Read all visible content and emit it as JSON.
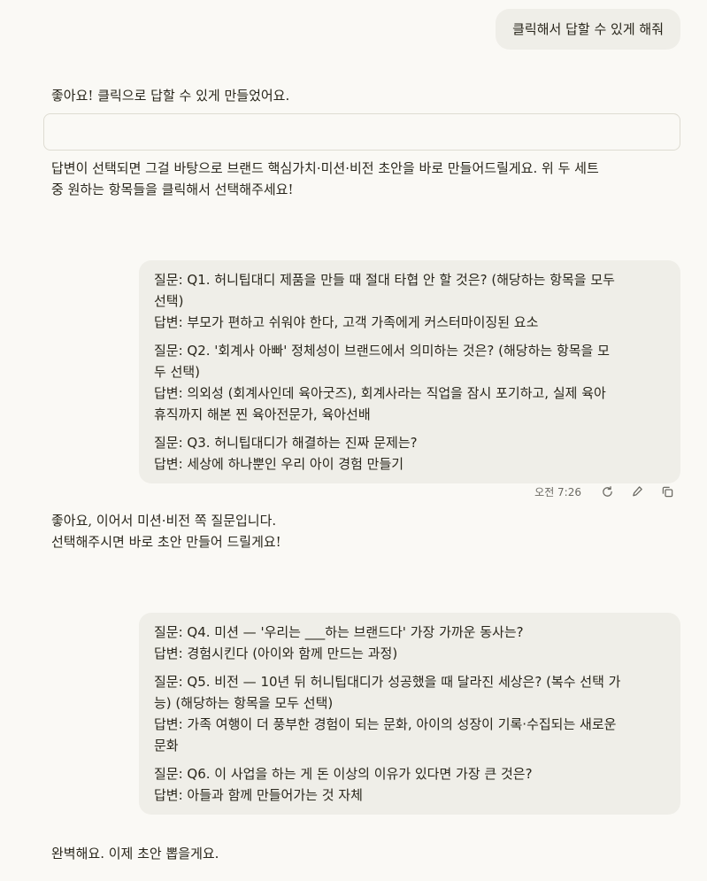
{
  "user_messages": {
    "first": "클릭해서 답할 수 있게 해줘"
  },
  "assistant": {
    "msg1_line1": "좋아요! 클릭으로 답할 수 있게 만들었어요.",
    "msg2_line1": "답변이 선택되면 그걸 바탕으로 브랜드 핵심가치·미션·비전 초안을 바로 만들어드릴게요. 위 두 세트",
    "msg2_line2": "중 원하는 항목들을 클릭해서 선택해주세요!",
    "msg3_line1": "좋아요, 이어서 미션·비전 쪽 질문입니다.",
    "msg3_line2": "선택해주시면 바로 초안 만들어 드릴게요!",
    "msg4_line1": "완벽해요. 이제 초안 뽑을게요."
  },
  "qa_set_1": [
    {
      "q_line1": "질문: Q1. 허니팁대디 제품을 만들 때 절대 타협 안 할 것은? (해당하는 항목을 모두",
      "q_line2": "선택)",
      "a_line1": "답변: 부모가 편하고 쉬워야 한다, 고객 가족에게 커스터마이징된 요소"
    },
    {
      "q_line1": "질문: Q2. '회계사 아빠' 정체성이 브랜드에서 의미하는 것은? (해당하는 항목을 모",
      "q_line2": "두 선택)",
      "a_line1": "답변: 의외성 (회계사인데 육아굿즈), 회계사라는 직업을 잠시 포기하고, 실제 육아",
      "a_line2": "휴직까지 해본 찐 육아전문가, 육아선배"
    },
    {
      "q_line1": "질문: Q3. 허니팁대디가 해결하는 진짜 문제는?",
      "a_line1": "답변: 세상에 하나뿐인 우리 아이 경험 만들기"
    }
  ],
  "qa_set_2": [
    {
      "q_line1": "질문: Q4. 미션 — '우리는 ___하는 브랜드다' 가장 가까운 동사는?",
      "a_line1": "답변: 경험시킨다 (아이와 함께 만드는 과정)"
    },
    {
      "q_line1": "질문: Q5. 비전 — 10년 뒤 허니팁대디가 성공했을 때 달라진 세상은? (복수 선택 가",
      "q_line2": "능) (해당하는 항목을 모두 선택)",
      "a_line1": "답변: 가족 여행이 더 풍부한 경험이 되는 문화, 아이의 성장이 기록·수집되는 새로운",
      "a_line2": "문화"
    },
    {
      "q_line1": "질문: Q6. 이 사업을 하는 게 돈 이상의 이유가 있다면 가장 큰 것은?",
      "a_line1": "답변: 아들과 함께 만들어가는 것 자체"
    }
  ],
  "message_meta": {
    "time": "오전 7:26",
    "icons": [
      "retry-icon",
      "edit-icon",
      "copy-icon"
    ]
  },
  "colors": {
    "background": "#faf9f5",
    "bubble": "#efeee8",
    "text": "#29261b",
    "muted": "#6b6a63",
    "border": "#dedcd2"
  }
}
